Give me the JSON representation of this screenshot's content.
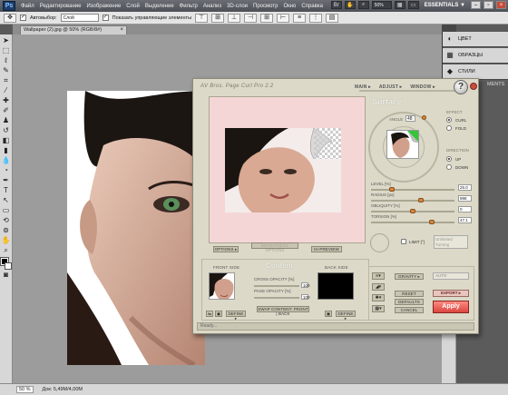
{
  "menubar": {
    "logo": "Ps",
    "items": [
      "Файл",
      "Редактирование",
      "Изображение",
      "Слой",
      "Выделение",
      "Фильтр",
      "Анализ",
      "3D-слои",
      "Просмотр",
      "Окно",
      "Справка"
    ],
    "zoom": "50%",
    "workspace": "ESSENTIALS ▼"
  },
  "options_bar": {
    "autoselect_label": "Автовыбор:",
    "autoselect_value": "Слой",
    "show_controls_label": "Показать управляющие элементы"
  },
  "document": {
    "tab_title": "Wallpaper (2).jpg @ 50% (RGB/8#)",
    "close_glyph": "×"
  },
  "right_panels": {
    "items": [
      {
        "icon": "color-icon",
        "label": "ЦВЕТ"
      },
      {
        "icon": "swatches-icon",
        "label": "ОБРАЗЦЫ"
      },
      {
        "icon": "styles-icon",
        "label": "СТИЛИ"
      }
    ],
    "partial_label": "MENTS"
  },
  "statusbar": {
    "zoom": "50 %",
    "doc_info": "Док: 5,49M/4,00M"
  },
  "plugin": {
    "title": "AV Bros. Page Curl Pro 2.2",
    "menus": [
      "MAIN ▸",
      "ADJUST ▸",
      "WINDOW ▸"
    ],
    "help": "?",
    "surface_title": "Surface",
    "angle_label": "ANGLE",
    "angle_value": "48",
    "effect_label": "EFFECT",
    "effect_options": [
      "CURL",
      "FOLD"
    ],
    "effect_selected": "CURL",
    "direction_label": "DIRECTION",
    "direction_options": [
      "UP",
      "DOWN"
    ],
    "direction_selected": "UP",
    "sliders": [
      {
        "label": "LEVEL [%]",
        "value": "25.0",
        "level": 0.25
      },
      {
        "label": "RADIUS [px]",
        "value": "988",
        "level": 0.6
      },
      {
        "label": "OBLIQUITY [%]",
        "value": "0",
        "level": 0.5
      },
      {
        "label": "TORSION [%]",
        "value": "47.1",
        "level": 0.73
      }
    ],
    "limit_label": "LIMIT [°]",
    "limit_field": "Unlimited Turning",
    "options_btn": "OPTIONS ▸",
    "brightness_btn": "BRIGHTNESS OPTIONS",
    "preview_btn": "HI-PREVIEW",
    "content_title": "Content",
    "front_side_label": "FRONT SIDE",
    "back_side_label": "BACK SIDE",
    "cross_opacity_label": "CROSS OPACITY [%]",
    "cross_opacity_value": "100",
    "page_opacity_label": "PAGE OPACITY [%]",
    "page_opacity_value": "100",
    "define_front": "DEFINE ▸",
    "define_back": "DEFINE ▸",
    "swap_btn": "SWAP CONTENT: FRONT | BACK",
    "gravity_btn": "GRAVITY ▸",
    "auto_field": "AUTO",
    "reset_btn": "RESET",
    "defaults_btn": "DEFAULTS",
    "cancel_btn": "CANCEL",
    "export_btn": "EXPORT ▸",
    "apply_btn": "Apply",
    "status": "Ready..."
  }
}
